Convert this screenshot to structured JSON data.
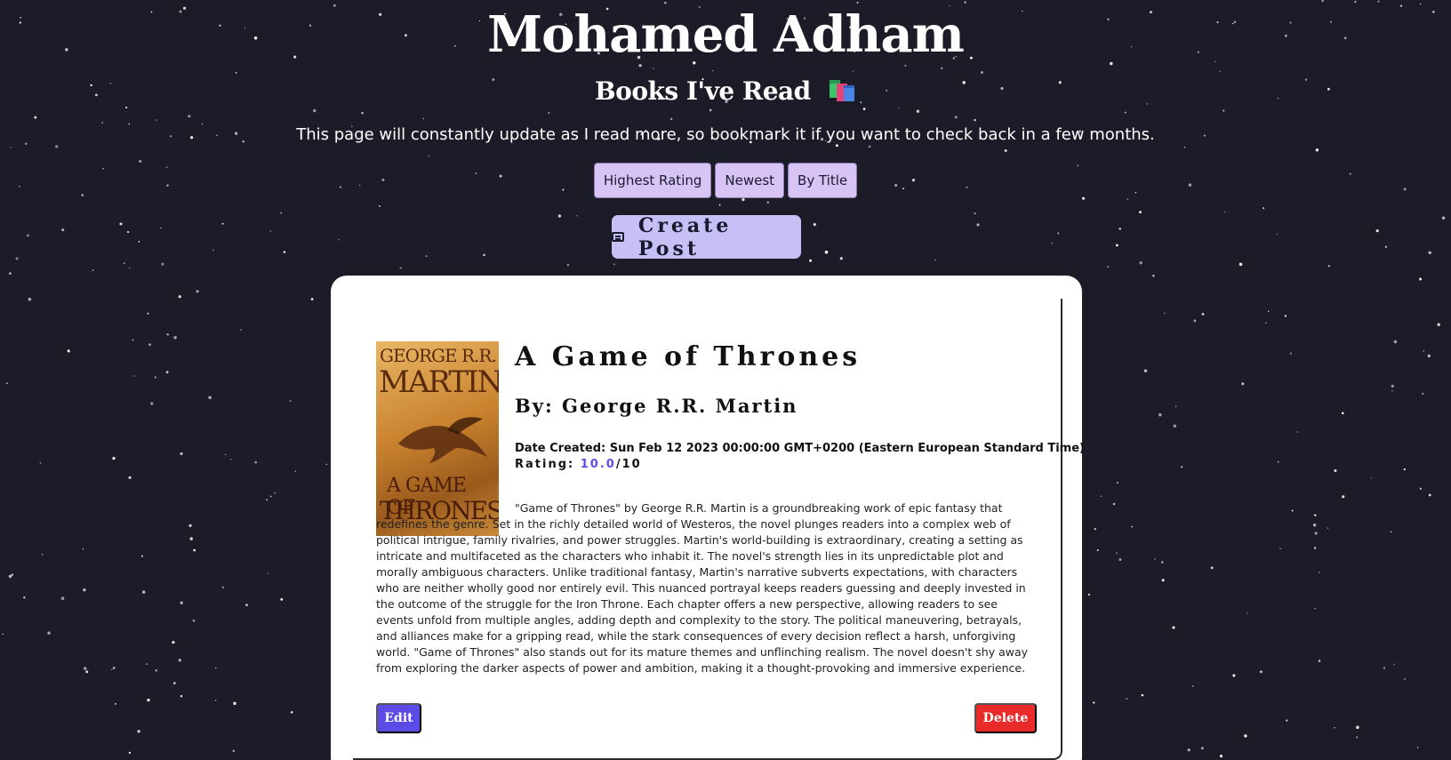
{
  "header": {
    "title": "Mohamed Adham",
    "subtitle": "Books I've Read",
    "intro": "This page will constantly update as I read more, so bookmark it if you want to check back in a few months."
  },
  "sort": {
    "highest_rating": "Highest Rating",
    "newest": "Newest",
    "by_title": "By Title"
  },
  "create_post": {
    "label": "Create Post",
    "icon": "note-icon"
  },
  "posts": [
    {
      "title": "A Game of Thrones",
      "author": "By: George R.R. Martin",
      "date": "Date Created: Sun Feb 12 2023 00:00:00 GMT+0200 (Eastern European Standard Time)",
      "rating_label": "Rating: ",
      "rating_value": "10.0",
      "rating_max": "/10",
      "cover": {
        "author_line1": "GEORGE R.R.",
        "author_line2": "MARTIN",
        "title_line1": "A GAME OF",
        "title_line2": "THRONES"
      },
      "review": "\"Game of Thrones\" by George R.R. Martin is a groundbreaking work of epic fantasy that redefines the genre. Set in the richly detailed world of Westeros, the novel plunges readers into a complex web of political intrigue, family rivalries, and power struggles. Martin's world-building is extraordinary, creating a setting as intricate and multifaceted as the characters who inhabit it. The novel's strength lies in its unpredictable plot and morally ambiguous characters. Unlike traditional fantasy, Martin's narrative subverts expectations, with characters who are neither wholly good nor entirely evil. This nuanced portrayal keeps readers guessing and deeply invested in the outcome of the struggle for the Iron Throne. Each chapter offers a new perspective, allowing readers to see events unfold from multiple angles, adding depth and complexity to the story. The political maneuvering, betrayals, and alliances make for a gripping read, while the stark consequences of every decision reflect a harsh, unforgiving world. \"Game of Thrones\" also stands out for its mature themes and unflinching realism. The novel doesn't shy away from exploring the darker aspects of power and ambition, making it a thought-provoking and immersive experience.",
      "edit_label": "Edit",
      "delete_label": "Delete"
    }
  ],
  "colors": {
    "background": "#1b1c28",
    "sort_button": "#d7c4f5",
    "create_button": "#c6c0f7",
    "edit_button": "#5b4ae6",
    "delete_button": "#e82a2a",
    "rating_accent": "#5b4de8"
  }
}
